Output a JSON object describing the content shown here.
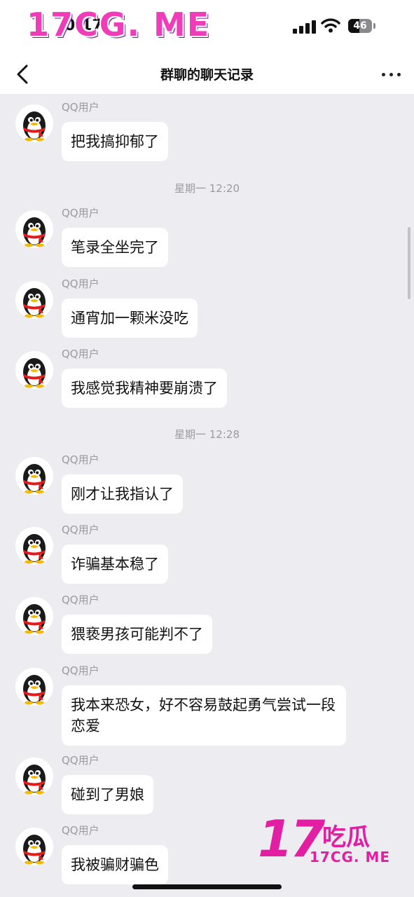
{
  "status_bar": {
    "time": "0:17",
    "battery": "46",
    "battery_level": 0.46
  },
  "watermark": {
    "top": "17CG. ME",
    "corner_big": "17",
    "corner_cn": "吃瓜",
    "corner_url": "17CG. ME"
  },
  "header": {
    "title": "群聊的聊天记录"
  },
  "messages": [
    {
      "type": "msg",
      "sender": "QQ用户",
      "text": "把我搞抑郁了"
    },
    {
      "type": "time",
      "text": "星期一 12:20"
    },
    {
      "type": "msg",
      "sender": "QQ用户",
      "text": "笔录全坐完了"
    },
    {
      "type": "msg",
      "sender": "QQ用户",
      "text": "通宵加一颗米没吃"
    },
    {
      "type": "msg",
      "sender": "QQ用户",
      "text": "我感觉我精神要崩溃了"
    },
    {
      "type": "time",
      "text": "星期一 12:28"
    },
    {
      "type": "msg",
      "sender": "QQ用户",
      "text": "刚才让我指认了"
    },
    {
      "type": "msg",
      "sender": "QQ用户",
      "text": "诈骗基本稳了"
    },
    {
      "type": "msg",
      "sender": "QQ用户",
      "text": "猥亵男孩可能判不了"
    },
    {
      "type": "msg",
      "sender": "QQ用户",
      "text": "我本来恐女，好不容易鼓起勇气尝试一段恋爱"
    },
    {
      "type": "msg",
      "sender": "QQ用户",
      "text": "碰到了男娘"
    },
    {
      "type": "msg",
      "sender": "QQ用户",
      "text": "我被骗财骗色"
    }
  ]
}
